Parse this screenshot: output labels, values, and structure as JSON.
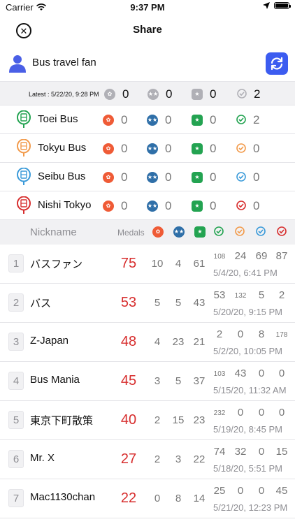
{
  "status_bar": {
    "carrier": "Carrier",
    "time": "9:37 PM"
  },
  "nav": {
    "title": "Share"
  },
  "user": {
    "name": "Bus travel fan"
  },
  "summary": {
    "latest": "Latest : 5/22/20, 9:28 PM",
    "values": [
      "0",
      "0",
      "0",
      "2"
    ]
  },
  "companies": [
    {
      "name": "Toei Bus",
      "values": [
        "0",
        "0",
        "0",
        "2"
      ],
      "color": "#23a351"
    },
    {
      "name": "Tokyu Bus",
      "values": [
        "0",
        "0",
        "0",
        "0"
      ],
      "color": "#f29a4a"
    },
    {
      "name": "Seibu Bus",
      "values": [
        "0",
        "0",
        "0",
        "0"
      ],
      "color": "#3a9ad9"
    },
    {
      "name": "Nishi Tokyo",
      "values": [
        "0",
        "0",
        "0",
        "0"
      ],
      "color": "#d72e2e"
    }
  ],
  "ranking": {
    "header": {
      "nickname": "Nickname",
      "medals": "Medals"
    },
    "rows": [
      {
        "rank": "1",
        "name": "バスファン",
        "total": "75",
        "m1": "10",
        "m2": "4",
        "m3": "61",
        "c": [
          "108",
          "24",
          "69",
          "87"
        ],
        "date": "5/4/20, 6:41 PM"
      },
      {
        "rank": "2",
        "name": "バス",
        "total": "53",
        "m1": "5",
        "m2": "5",
        "m3": "43",
        "c": [
          "53",
          "132",
          "5",
          "2"
        ],
        "date": "5/20/20, 9:15 PM"
      },
      {
        "rank": "3",
        "name": "Z-Japan",
        "total": "48",
        "m1": "4",
        "m2": "23",
        "m3": "21",
        "c": [
          "2",
          "0",
          "8",
          "178"
        ],
        "date": "5/2/20, 10:05 PM"
      },
      {
        "rank": "4",
        "name": "Bus Mania",
        "total": "45",
        "m1": "3",
        "m2": "5",
        "m3": "37",
        "c": [
          "103",
          "43",
          "0",
          "0"
        ],
        "date": "5/15/20, 11:32 AM"
      },
      {
        "rank": "5",
        "name": "東京下町散策",
        "total": "40",
        "m1": "2",
        "m2": "15",
        "m3": "23",
        "c": [
          "232",
          "0",
          "0",
          "0"
        ],
        "date": "5/19/20, 8:45 PM"
      },
      {
        "rank": "6",
        "name": "Mr. X",
        "total": "27",
        "m1": "2",
        "m2": "3",
        "m3": "22",
        "c": [
          "74",
          "32",
          "0",
          "15"
        ],
        "date": "5/18/20, 5:51 PM"
      },
      {
        "rank": "7",
        "name": "Mac1130chan",
        "total": "22",
        "m1": "0",
        "m2": "8",
        "m3": "14",
        "c": [
          "25",
          "0",
          "0",
          "45"
        ],
        "date": "5/21/20, 12:23 PM"
      }
    ]
  },
  "colors": {
    "accent": "#3c5cf0",
    "rank_red": "#d72e2e",
    "medal_red": "#ef5b36",
    "medal_blue": "#2f6fa8",
    "medal_green": "#23a351"
  },
  "icons": [
    "wifi-icon",
    "location-arrow-icon",
    "battery-icon",
    "close-icon",
    "user-icon",
    "refresh-icon",
    "bus-stop-icon",
    "medal-icon",
    "check-badge-icon"
  ]
}
